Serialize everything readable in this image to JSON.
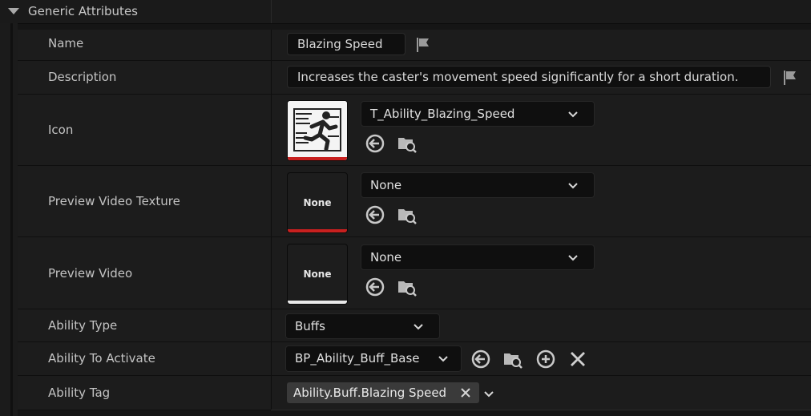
{
  "section": {
    "title": "Generic Attributes",
    "caret_icon": "caret-down-icon"
  },
  "rows": {
    "name": {
      "label": "Name",
      "value": "Blazing Speed"
    },
    "description": {
      "label": "Description",
      "value": "Increases the caster's movement speed significantly for a short duration."
    },
    "icon": {
      "label": "Icon",
      "asset": "T_Ability_Blazing_Speed"
    },
    "preview_video_texture": {
      "label": "Preview Video Texture",
      "asset": "None",
      "thumb_text": "None",
      "accent": "#c8201f"
    },
    "preview_video": {
      "label": "Preview Video",
      "asset": "None",
      "thumb_text": "None",
      "accent": "#e8e8e8"
    },
    "ability_type": {
      "label": "Ability Type",
      "value": "Buffs"
    },
    "ability_to_activate": {
      "label": "Ability To Activate",
      "value": "BP_Ability_Buff_Base"
    },
    "ability_tag": {
      "label": "Ability Tag",
      "tag": "Ability.Buff.Blazing Speed"
    }
  },
  "colors": {
    "background": "#151515",
    "row": "#1c1c1c",
    "field": "#0f0f0f",
    "chip": "#3a3a3a"
  }
}
